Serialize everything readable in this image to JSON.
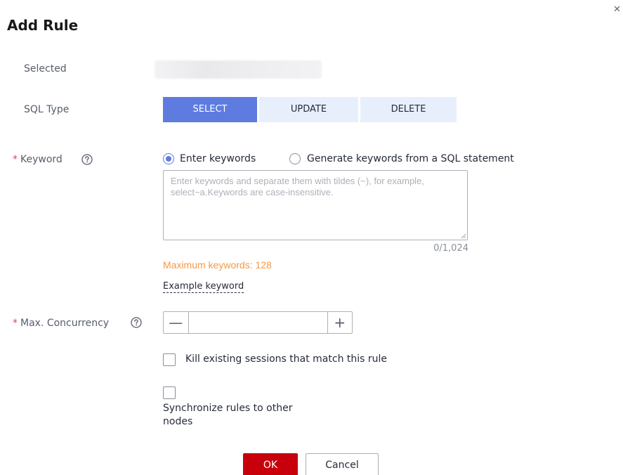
{
  "dialog": {
    "title": "Add Rule",
    "close_glyph": "×"
  },
  "selected": {
    "label": "Selected"
  },
  "sql_type": {
    "label": "SQL Type",
    "options": [
      "SELECT",
      "UPDATE",
      "DELETE"
    ],
    "selected": "SELECT"
  },
  "keyword": {
    "required_mark": "*",
    "label": "Keyword",
    "help_icon": "question-circle-icon",
    "mode_options": [
      "Enter keywords",
      "Generate keywords from a SQL statement"
    ],
    "selected_mode": "Enter keywords",
    "value": "",
    "placeholder": "Enter keywords and separate them with tildes (~), for example, select~a.Keywords are case-insensitive.",
    "counter": "0/1,024",
    "max_hint": "Maximum keywords: 128",
    "example_link": "Example keyword"
  },
  "max_concurrency": {
    "required_mark": "*",
    "label": "Max. Concurrency",
    "help_icon": "question-circle-icon",
    "value": "",
    "minus": "—",
    "plus": "+"
  },
  "options": {
    "kill_sessions": {
      "label": "Kill existing sessions that match this rule",
      "checked": false
    },
    "sync_rules": {
      "label": "Synchronize rules to other nodes",
      "checked": false
    }
  },
  "footer": {
    "ok_label": "OK",
    "cancel_label": "Cancel"
  },
  "colors": {
    "primary": "#5e7ce0",
    "segment_inactive": "#e8effc",
    "ok_button": "#c7000b",
    "warning_text": "#fa9841",
    "required": "#e0435a"
  }
}
